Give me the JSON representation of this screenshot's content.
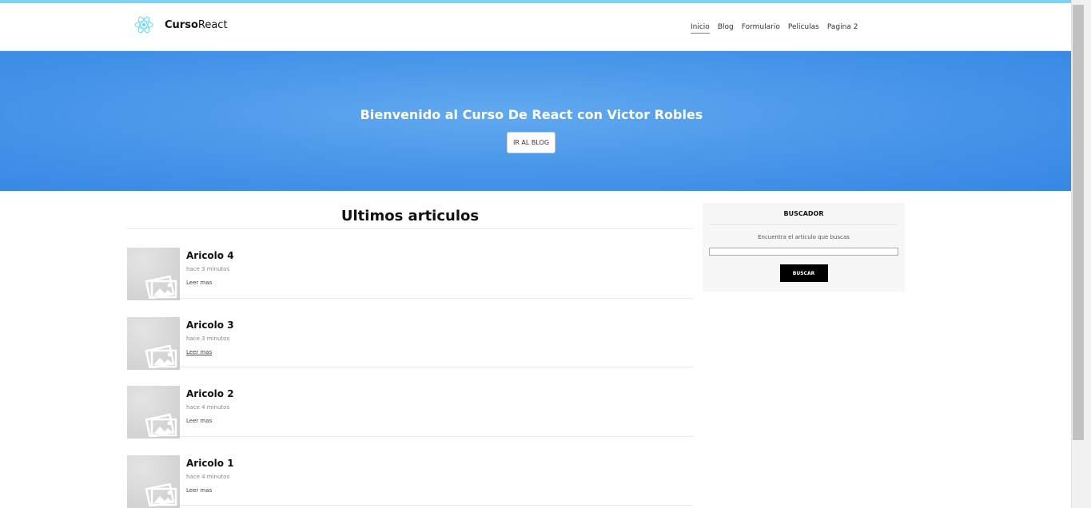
{
  "header": {
    "logo_bold": "Curso",
    "logo_regular": "React",
    "logo_icon": "react-atom-icon",
    "nav": [
      {
        "label": "Inicio",
        "active": true
      },
      {
        "label": "Blog",
        "active": false
      },
      {
        "label": "Formulario",
        "active": false
      },
      {
        "label": "Peliculas",
        "active": false
      },
      {
        "label": "Pagina 2",
        "active": false
      }
    ]
  },
  "hero": {
    "title": "Bienvenido al Curso De React con Victor Robles",
    "button_label": "IR AL BLOG"
  },
  "main": {
    "section_title": "Ultimos articulos",
    "articles": [
      {
        "title": "Aricolo 4",
        "time": "hace 3 minutos",
        "link": "Leer mas"
      },
      {
        "title": "Aricolo 3",
        "time": "hace 3 minutos",
        "link": "Leer mas"
      },
      {
        "title": "Aricolo 2",
        "time": "hace 4 minutos",
        "link": "Leer mas"
      },
      {
        "title": "Aricolo 1",
        "time": "hace 4 minutos",
        "link": "Leer mas"
      }
    ]
  },
  "sidebar": {
    "title": "BUSCADOR",
    "description": "Encuentra el articulo que buscas",
    "search_value": "",
    "button_label": "BUSCAR"
  },
  "colors": {
    "accent": "#61dafb",
    "hero": "#3f8fe6",
    "button_dark": "#000000"
  }
}
